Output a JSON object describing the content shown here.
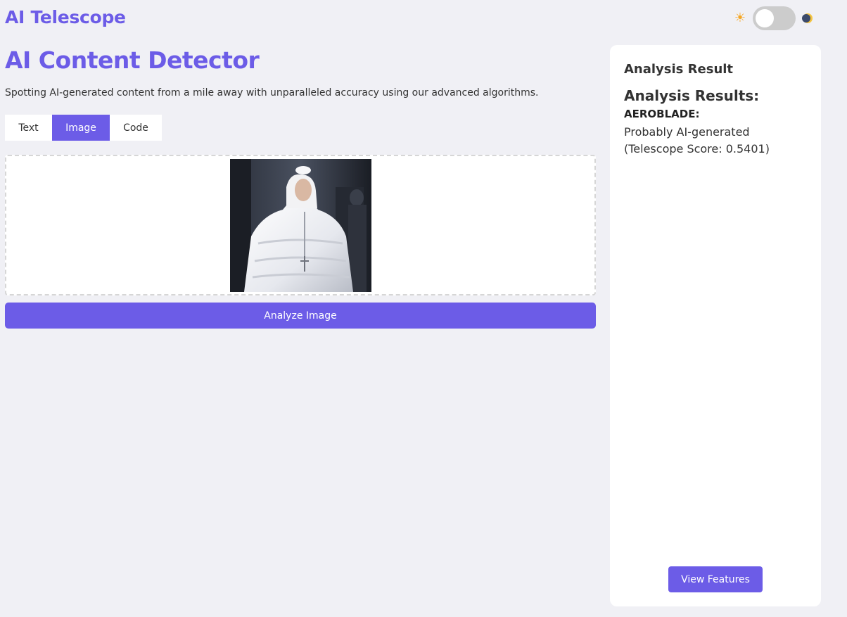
{
  "header": {
    "brand": "AI Telescope",
    "theme": {
      "light_icon": "sun-icon",
      "dark_icon": "moon-icon",
      "dark_mode": false
    }
  },
  "main": {
    "title": "AI Content Detector",
    "subtitle": "Spotting AI-generated content from a mile away with unparalleled accuracy using our advanced algorithms.",
    "tabs": [
      {
        "label": "Text",
        "active": false
      },
      {
        "label": "Image",
        "active": true
      },
      {
        "label": "Code",
        "active": false
      }
    ],
    "analyze_label": "Analyze Image"
  },
  "result": {
    "heading": "Analysis Result",
    "title": "Analysis Results:",
    "model": "AEROBLADE:",
    "verdict": "Probably AI-generated",
    "score": "(Telescope Score: 0.5401)",
    "view_features_label": "View Features"
  },
  "colors": {
    "accent": "#6c5ce7",
    "background": "#f0f0f5",
    "panel": "#ffffff"
  }
}
